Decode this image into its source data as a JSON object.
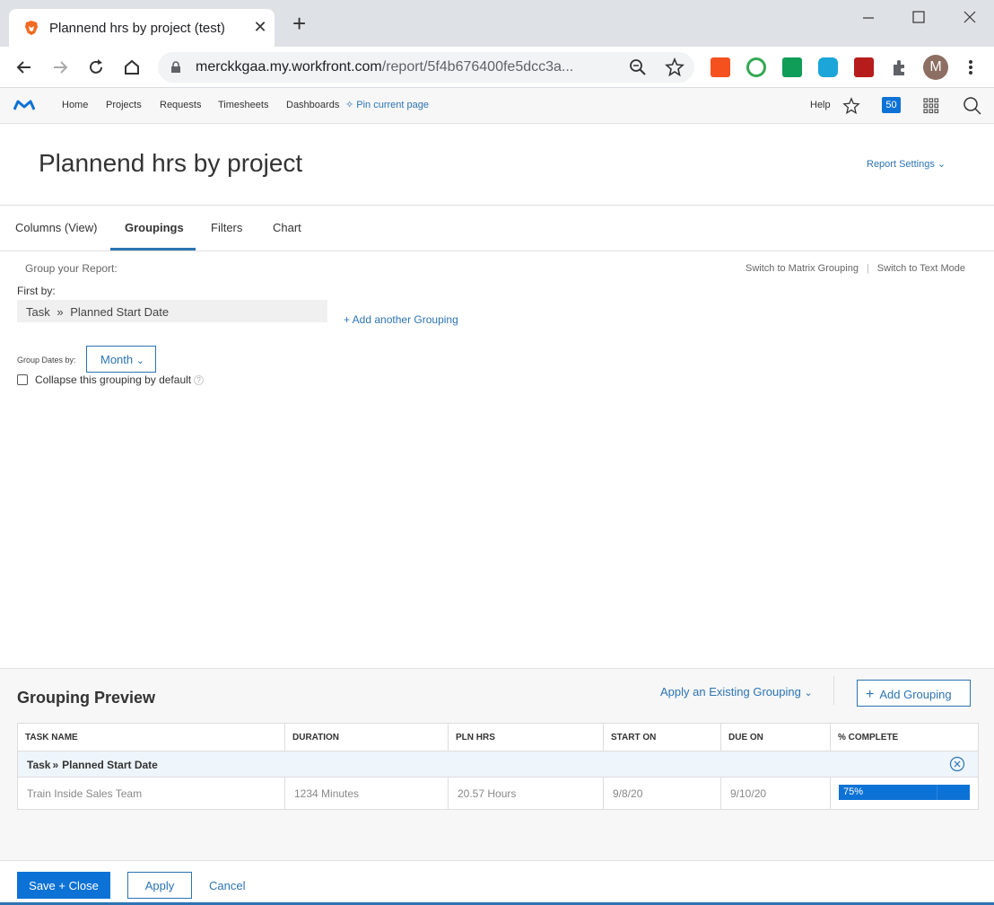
{
  "browser": {
    "tab_title": "Plannend hrs by project (test)",
    "url_host": "merckkgaa.my.workfront.com",
    "url_rest": "/report/5f4b676400fe5dcc3a...",
    "avatar_letter": "M"
  },
  "wf_nav": {
    "home": "Home",
    "projects": "Projects",
    "requests": "Requests",
    "timesheets": "Timesheets",
    "dashboards": "Dashboards",
    "pin": "Pin current page",
    "help": "Help",
    "badge_count": "50"
  },
  "page": {
    "title": "Plannend hrs by project",
    "report_settings": "Report Settings"
  },
  "tabs": [
    {
      "label": "Columns (View)"
    },
    {
      "label": "Groupings"
    },
    {
      "label": "Filters"
    },
    {
      "label": "Chart"
    }
  ],
  "grouping": {
    "group_label": "Group your Report:",
    "switch_matrix": "Switch to Matrix Grouping",
    "switch_text": "Switch to Text Mode",
    "first_by": "First by:",
    "field_obj": "Task",
    "field_name": "Planned Start Date",
    "add_another": "+ Add another Grouping",
    "group_dates_by": "Group Dates by:",
    "month": "Month",
    "collapse_label": "Collapse this grouping by default",
    "collapse_checked": false
  },
  "preview": {
    "title": "Grouping Preview",
    "apply_existing": "Apply an Existing Grouping",
    "add_grouping": "Add Grouping",
    "columns": [
      "TASK NAME",
      "DURATION",
      "PLN HRS",
      "START ON",
      "DUE ON",
      "% COMPLETE"
    ],
    "group_row_obj": "Task",
    "group_row_name": "Planned Start Date",
    "row": {
      "task_name": "Train Inside Sales Team",
      "duration": "1234 Minutes",
      "pln_hrs": "20.57 Hours",
      "start_on": "9/8/20",
      "due_on": "9/10/20",
      "complete": "75%",
      "complete_fraction": 0.75
    }
  },
  "footer": {
    "save_close": "Save + Close",
    "apply": "Apply",
    "cancel": "Cancel"
  },
  "colors": {
    "accent": "#2c74b3",
    "primary_button": "#0d72d5"
  }
}
